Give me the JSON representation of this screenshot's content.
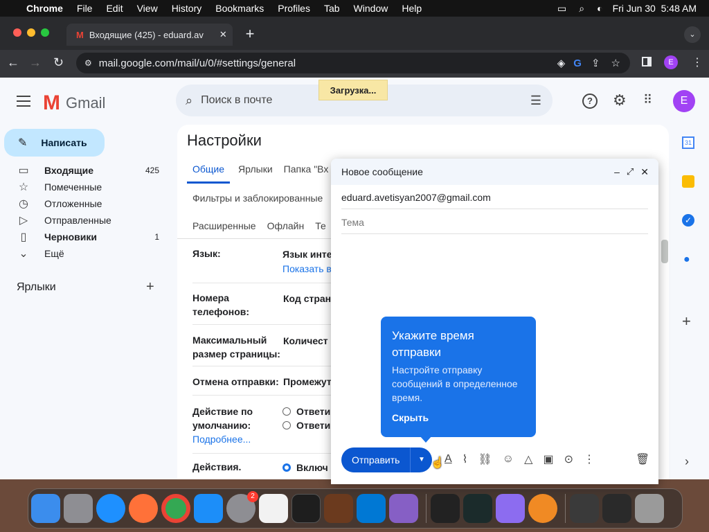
{
  "menubar": {
    "app": "Chrome",
    "items": [
      "File",
      "Edit",
      "View",
      "History",
      "Bookmarks",
      "Profiles",
      "Tab",
      "Window",
      "Help"
    ],
    "datetime": "Fri Jun 30  5:48 AM"
  },
  "tab": {
    "title": "Входящие (425) - eduard.av"
  },
  "omnibox": {
    "url": "mail.google.com/mail/u/0/#settings/general"
  },
  "gmail": {
    "logo": "Gmail",
    "search_placeholder": "Поиск в почте",
    "loading": "Загрузка...",
    "avatar": "E"
  },
  "nav": {
    "compose": "Написать",
    "items": [
      {
        "label": "Входящие",
        "count": "425",
        "bold": true,
        "icon": "inbox-icon"
      },
      {
        "label": "Помеченные",
        "count": "",
        "icon": "star-icon"
      },
      {
        "label": "Отложенные",
        "count": "",
        "icon": "clock-icon"
      },
      {
        "label": "Отправленные",
        "count": "",
        "icon": "send-icon"
      },
      {
        "label": "Черновики",
        "count": "1",
        "bold": true,
        "icon": "draft-icon"
      },
      {
        "label": "Ещё",
        "count": "",
        "icon": "chevron-down-icon"
      }
    ],
    "labels_heading": "Ярлыки"
  },
  "settings": {
    "title": "Настройки",
    "tabs": [
      "Общие",
      "Ярлыки",
      "Папка \"Вх"
    ],
    "tabs2": [
      "Фильтры и заблокированные"
    ],
    "tabs3": [
      "Расширенные",
      "Офлайн",
      "Те"
    ],
    "rows": [
      {
        "label": "Язык:",
        "value": "Язык инте",
        "link": "Показать в"
      },
      {
        "label": "Номера телефонов:",
        "value": "Код стран"
      },
      {
        "label": "Максимальный размер страницы:",
        "value": "Количест"
      },
      {
        "label": "Отмена отправки:",
        "value": "Промежут"
      },
      {
        "label": "Действие по умолчанию:",
        "opt1": "Ответи",
        "opt2": "Ответи",
        "link": "Подробнее..."
      },
      {
        "label": "Действия.",
        "opt1": "Включ"
      }
    ]
  },
  "compose": {
    "title": "Новое сообщение",
    "to": "eduard.avetisyan2007@gmail.com",
    "subject_placeholder": "Тема",
    "send": "Отправить"
  },
  "tooltip": {
    "title": "Укажите время отправки",
    "body": "Настройте отправку сообщений в определенное время.",
    "dismiss": "Скрыть"
  }
}
